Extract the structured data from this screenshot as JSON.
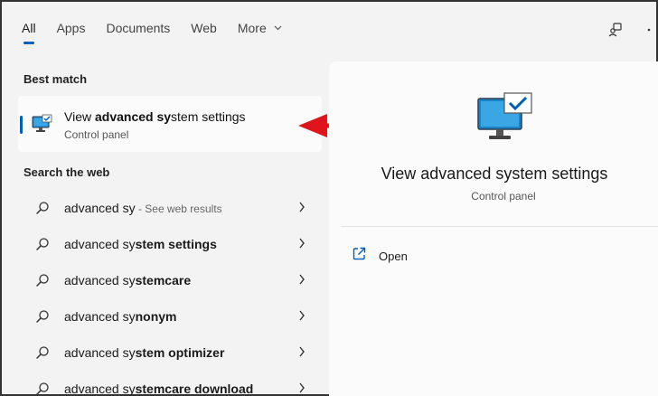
{
  "tabs": [
    {
      "label": "All",
      "active": true
    },
    {
      "label": "Apps"
    },
    {
      "label": "Documents"
    },
    {
      "label": "Web"
    },
    {
      "label": "More"
    }
  ],
  "top_icons": [
    "account-switch-icon",
    "more-options-icon"
  ],
  "best_match": {
    "section_title": "Best match",
    "title_pre": "View ",
    "title_bold": "advanced sy",
    "title_post": "stem settings",
    "subtitle": "Control panel",
    "icon": "system-monitor-icon"
  },
  "search_web": {
    "section_title": "Search the web",
    "items": [
      {
        "prefix": "advanced sy",
        "bold": "",
        "hint": " - See web results"
      },
      {
        "prefix": "advanced sy",
        "bold": "stem settings",
        "hint": ""
      },
      {
        "prefix": "advanced sy",
        "bold": "stemcare",
        "hint": ""
      },
      {
        "prefix": "advanced sy",
        "bold": "nonym",
        "hint": ""
      },
      {
        "prefix": "advanced sy",
        "bold": "stem optimizer",
        "hint": ""
      },
      {
        "prefix": "advanced sy",
        "bold": "stemcare download",
        "hint": ""
      }
    ]
  },
  "detail_panel": {
    "title": "View advanced system settings",
    "subtitle": "Control panel",
    "actions": [
      {
        "label": "Open",
        "icon": "open-external-icon"
      }
    ]
  },
  "colors": {
    "accent": "#005fb8",
    "annotation_arrow": "#e0141b",
    "background": "#f3f3f3"
  }
}
